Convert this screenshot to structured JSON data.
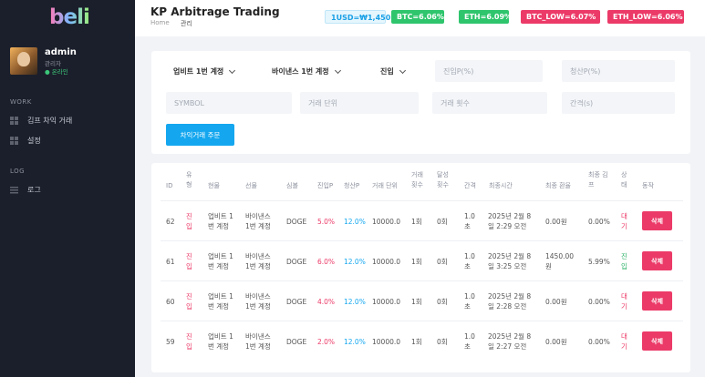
{
  "sidebar": {
    "logo": "beli",
    "user": {
      "name": "admin",
      "role": "관리자",
      "status": "● 온라인"
    },
    "sections": [
      {
        "title": "WORK",
        "items": [
          {
            "label": "김프 차익 거래",
            "icon": "grid-icon"
          },
          {
            "label": "설정",
            "icon": "grid-icon"
          }
        ]
      },
      {
        "title": "LOG",
        "items": [
          {
            "label": "로그",
            "icon": "list-icon"
          }
        ]
      }
    ]
  },
  "header": {
    "title": "KP Arbitrage Trading",
    "breadcrumb": {
      "home": "Home",
      "current": "관리"
    },
    "badges": {
      "rate": "1USD=₩1,450",
      "btc": "BTC=6.06%",
      "eth": "ETH=6.09%",
      "btc_low": "BTC_LOW=6.07%",
      "eth_low": "ETH_LOW=6.06%"
    },
    "colors": {
      "green": "#2fc56d",
      "red": "#ec3a68",
      "blue": "#14a7ef"
    }
  },
  "form": {
    "spot_select": "업비트 1번 계정",
    "futures_select": "바이낸스 1번 계정",
    "type_select": "진입",
    "entry_p_placeholder": "진입P(%)",
    "exit_p_placeholder": "청산P(%)",
    "symbol_placeholder": "SYMBOL",
    "unit_placeholder": "거래 단위",
    "count_placeholder": "거래 횟수",
    "interval_placeholder": "간격(s)",
    "submit_label": "차익거래 주문"
  },
  "table": {
    "headers": {
      "id": "ID",
      "type": [
        "유",
        "형"
      ],
      "spot": "현물",
      "futures": "선물",
      "symbol": "심볼",
      "entry_p": "진입P",
      "exit_p": "청산P",
      "unit": "거래 단위",
      "count": [
        "거래",
        "횟수"
      ],
      "done": [
        "달성",
        "횟수"
      ],
      "interval": "간격",
      "time": "최종시간",
      "rate": "최종 환율",
      "premium": [
        "최종 김",
        "프"
      ],
      "status": [
        "상",
        "태"
      ],
      "action": "동작"
    },
    "rows": [
      {
        "id": "62",
        "type": [
          "진",
          "입"
        ],
        "spot": [
          "업비트 1",
          "번 계정"
        ],
        "futures": [
          "바이낸스",
          "1번 계정"
        ],
        "symbol": "DOGE",
        "entry_p": "5.0%",
        "exit_p": "12.0%",
        "unit": "10000.0",
        "count": "1회",
        "done": "0회",
        "interval": [
          "1.0",
          "초"
        ],
        "time": [
          "2025년 2월 8",
          "일 2:29 오전"
        ],
        "rate": [
          "0.00원"
        ],
        "premium": "0.00%",
        "status": [
          "대",
          "기"
        ],
        "action": "삭제"
      },
      {
        "id": "61",
        "type": [
          "진",
          "입"
        ],
        "spot": [
          "업비트 1",
          "번 계정"
        ],
        "futures": [
          "바이낸스",
          "1번 계정"
        ],
        "symbol": "DOGE",
        "entry_p": "6.0%",
        "exit_p": "12.0%",
        "unit": "10000.0",
        "count": "1회",
        "done": "0회",
        "interval": [
          "1.0",
          "초"
        ],
        "time": [
          "2025년 2월 8",
          "일 3:25 오전"
        ],
        "rate": [
          "1450.00",
          "원"
        ],
        "premium": "5.99%",
        "status": [
          "진",
          "입"
        ],
        "action": "삭제"
      },
      {
        "id": "60",
        "type": [
          "진",
          "입"
        ],
        "spot": [
          "업비트 1",
          "번 계정"
        ],
        "futures": [
          "바이낸스",
          "1번 계정"
        ],
        "symbol": "DOGE",
        "entry_p": "4.0%",
        "exit_p": "12.0%",
        "unit": "10000.0",
        "count": "1회",
        "done": "0회",
        "interval": [
          "1.0",
          "초"
        ],
        "time": [
          "2025년 2월 8",
          "일 2:28 오전"
        ],
        "rate": [
          "0.00원"
        ],
        "premium": "0.00%",
        "status": [
          "대",
          "기"
        ],
        "action": "삭제"
      },
      {
        "id": "59",
        "type": [
          "진",
          "입"
        ],
        "spot": [
          "업비트 1",
          "번 계정"
        ],
        "futures": [
          "바이낸스",
          "1번 계정"
        ],
        "symbol": "DOGE",
        "entry_p": "2.0%",
        "exit_p": "12.0%",
        "unit": "10000.0",
        "count": "1회",
        "done": "0회",
        "interval": [
          "1.0",
          "초"
        ],
        "time": [
          "2025년 2월 8",
          "일 2:27 오전"
        ],
        "rate": [
          "0.00원"
        ],
        "premium": "0.00%",
        "status": [
          "대",
          "기"
        ],
        "action": "삭제"
      }
    ]
  }
}
